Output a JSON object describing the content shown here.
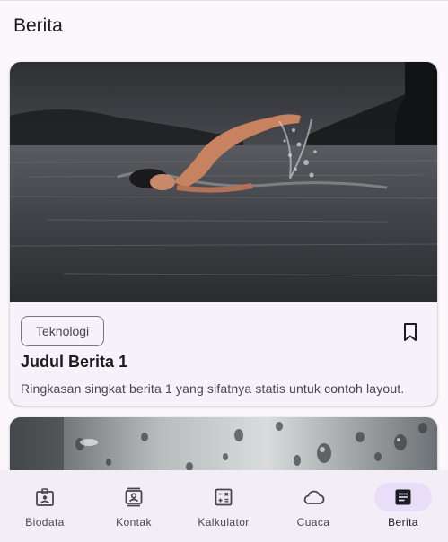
{
  "app_bar": {
    "title": "Berita"
  },
  "articles": [
    {
      "category": "Teknologi",
      "title": "Judul Berita 1",
      "summary": "Ringkasan singkat berita 1 yang sifatnya statis untuk contoh layout.",
      "image": "swimmer-in-lake-photo",
      "bookmark_icon": "bookmark-outline-icon"
    },
    {
      "image": "water-droplets-on-glass-photo"
    }
  ],
  "bottom_nav": {
    "items": [
      {
        "label": "Biodata",
        "icon": "badge-icon",
        "active": false
      },
      {
        "label": "Kontak",
        "icon": "contacts-icon",
        "active": false
      },
      {
        "label": "Kalkulator",
        "icon": "calculator-icon",
        "active": false
      },
      {
        "label": "Cuaca",
        "icon": "cloud-icon",
        "active": false
      },
      {
        "label": "Berita",
        "icon": "article-icon",
        "active": true
      }
    ]
  },
  "colors": {
    "background": "#fbf7fc",
    "card": "#f7f2fa",
    "nav_background": "#f2edf6",
    "active_indicator": "#e8def8"
  }
}
